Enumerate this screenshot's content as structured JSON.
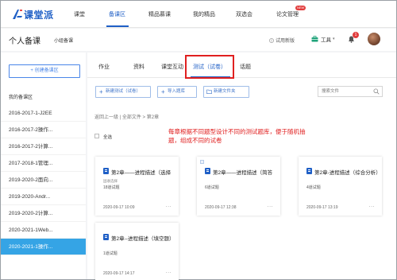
{
  "topnav": {
    "logo_text": "课堂派",
    "items": [
      "课堂",
      "备课区",
      "精品慕课",
      "我的精品",
      "双选会",
      "论文管理"
    ],
    "badge": "NEW"
  },
  "subheader": {
    "title": "个人备课",
    "subtitle": "小组备课",
    "trial": "试用新版",
    "tools": "工具",
    "notification_count": "1"
  },
  "sidebar": {
    "create_button": "+ 创建备课区",
    "my_label": "我的备课区",
    "items": [
      "2016-2017-1-J2EE",
      "2016-2017-2操作...",
      "2016-2017-2计算...",
      "2017-2018-1管理...",
      "2019-2020-2面向...",
      "2019-2020-Andr...",
      "2019-2020-2计算...",
      "2020-2021-1Web...",
      "2020-2021-1操作..."
    ]
  },
  "main": {
    "tabs": [
      "作业",
      "资料",
      "课堂互动",
      "测试（试卷）",
      "话题"
    ],
    "actions": [
      "新建测试（试卷）",
      "导入题库",
      "新建文件夹"
    ],
    "search_placeholder": "搜索文件",
    "breadcrumb": "返回上一级 | 全部文件 > 第2章",
    "select_all": "全选",
    "annotation": "每章根据不同题型设计不同的测试题库，便于随机抽题，组成不同的试卷",
    "cards": [
      {
        "title": "第2章——进程描述（选择",
        "line1": "固收选择",
        "line2": "18道试题",
        "date": "2020-09-17 10:09"
      },
      {
        "title": "第2章——进程描述（简答",
        "line1": "",
        "line2": "6道试题",
        "date": "2020-09-17 12:38"
      },
      {
        "title": "第2章-进程描述（综合分析）",
        "line1": "",
        "line2": "4道试题",
        "date": "2020-09-17 13:19"
      },
      {
        "title": "第2章--进程描述（填空题）",
        "line1": "",
        "line2": "1道试题",
        "date": "2020-09-17 14:17"
      }
    ],
    "more": "..."
  },
  "colors": {
    "accent": "#1f5fc6",
    "sidebar_active": "#35a4e5",
    "annotation": "#e02020"
  }
}
